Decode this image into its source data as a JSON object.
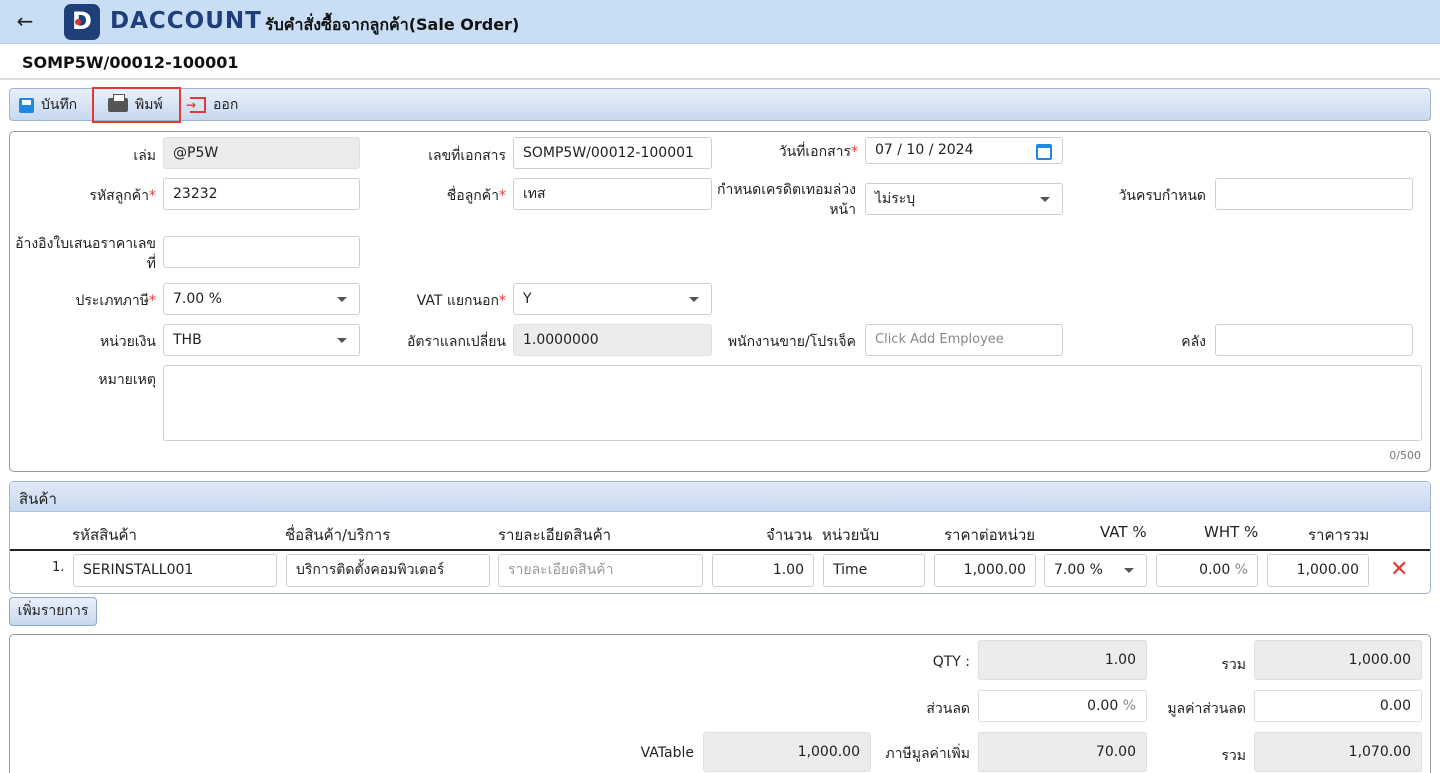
{
  "header": {
    "brand": "DACCOUNT",
    "brand_initial": "D",
    "title": "รับคำสั่งซื้อจากลูกค้า(Sale Order)"
  },
  "doc_number": "SOMP5W/00012-100001",
  "toolbar": {
    "save_label": "บันทึก",
    "print_label": "พิมพ์",
    "exit_label": "ออก"
  },
  "form": {
    "book_label": "เล่ม",
    "book_value": "@P5W",
    "docno_label": "เลขที่เอกสาร",
    "docno_value": "SOMP5W/00012-100001",
    "docdate_label": "วันที่เอกสาร",
    "docdate_value": "07 / 10 /  2024",
    "customer_code_label": "รหัสลูกค้า",
    "customer_code_value": "23232",
    "customer_name_label": "ชื่อลูกค้า",
    "customer_name_value": "เทส",
    "credit_label_line1": "กำหนดเครดิตเทอมล่วง",
    "credit_label_line2": "หน้า",
    "credit_value": "ไม่ระบุ",
    "due_date_label": "วันครบกำหนด",
    "due_date_value": "",
    "quote_ref_label_line1": "อ้างอิงใบเสนอราคาเลข",
    "quote_ref_label_line2": "ที่",
    "quote_ref_value": "",
    "tax_type_label": "ประเภทภาษี",
    "tax_type_value": "7.00 %",
    "vat_sep_label": "VAT แยกนอก",
    "vat_sep_value": "Y",
    "currency_label": "หน่วยเงิน",
    "currency_value": "THB",
    "rate_label": "อัตราแลกเปลี่ยน",
    "rate_value": "1.0000000",
    "employee_label": "พนักงานขาย/โปรเจ็ค",
    "employee_placeholder": "Click Add Employee",
    "warehouse_label": "คลัง",
    "warehouse_value": "",
    "remark_label": "หมายเหตุ",
    "remark_counter": "0/500"
  },
  "products": {
    "title": "สินค้า",
    "columns": {
      "code": "รหัสสินค้า",
      "name": "ชื่อสินค้า/บริการ",
      "detail": "รายละเอียดสินค้า",
      "qty": "จำนวน",
      "unit": "หน่วยนับ",
      "price": "ราคาต่อหน่วย",
      "vat": "VAT %",
      "wht": "WHT %",
      "total": "ราคารวม"
    },
    "rows": [
      {
        "no": "1.",
        "code": "SERINSTALL001",
        "name": "บริการติดตั้งคอมพิวเตอร์",
        "detail_placeholder": "รายละเอียดสินค้า",
        "qty": "1.00",
        "unit": "Time",
        "price": "1,000.00",
        "vat": "7.00 %",
        "wht": "0.00",
        "wht_unit": "%",
        "total": "1,000.00"
      }
    ],
    "add_label": "เพิ่มรายการ"
  },
  "summary": {
    "qty_label": "QTY :",
    "qty_value": "1.00",
    "sum_label": "รวม",
    "sum_value": "1,000.00",
    "discount_label": "ส่วนลด",
    "discount_value": "0.00",
    "discount_unit": "%",
    "discount_amount_label": "มูลค่าส่วนลด",
    "discount_amount_value": "0.00",
    "vatable_label": "VATable",
    "vatable_value": "1,000.00",
    "vat_label": "ภาษีมูลค่าเพิ่ม",
    "vat_value": "70.00",
    "grand_label": "รวม",
    "grand_value": "1,070.00"
  },
  "colors": {
    "header_bg": "#c9def5",
    "brand": "#1e3f7a",
    "accent_red": "#e53935",
    "accent_blue": "#1e88e5"
  },
  "icons": {
    "back": "arrow-left-icon",
    "save": "floppy-disk-icon",
    "print": "printer-icon",
    "exit": "exit-icon",
    "calendar": "calendar-icon",
    "delete": "close-icon"
  }
}
